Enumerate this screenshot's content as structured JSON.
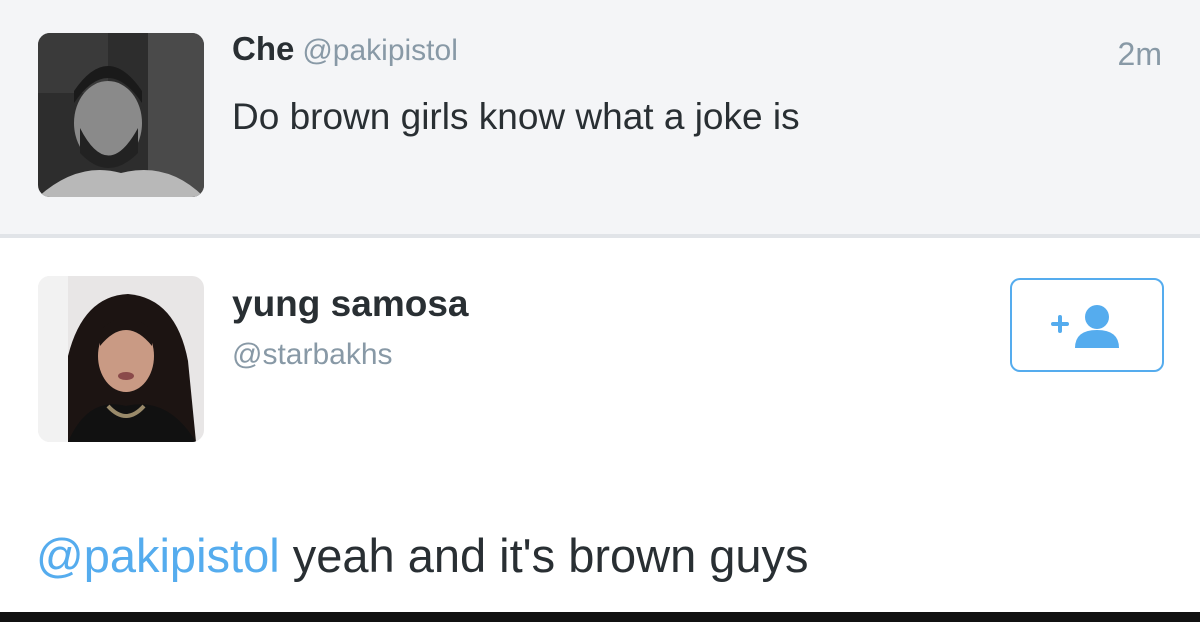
{
  "original_tweet": {
    "display_name": "Che",
    "handle": "@pakipistol",
    "timestamp": "2m",
    "text": "Do brown girls know what a joke is"
  },
  "reply": {
    "display_name": "yung samosa",
    "handle": "@starbakhs",
    "mention": "@pakipistol",
    "text": " yeah and it's brown guys"
  },
  "follow_button": {
    "icon": "add-user-icon"
  },
  "colors": {
    "accent": "#55acee",
    "secondary_text": "#8899a6",
    "primary_text": "#292f33",
    "top_background": "#f4f5f7"
  }
}
